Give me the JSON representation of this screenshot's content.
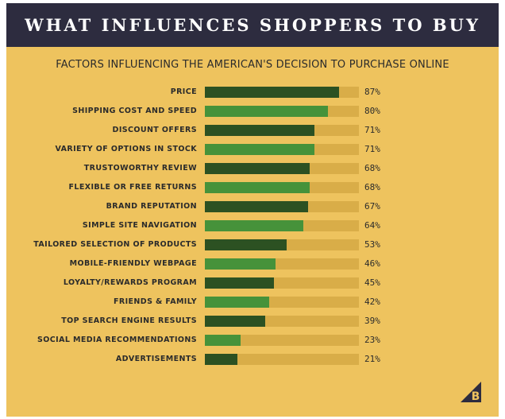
{
  "header": {
    "title": "WHAT INFLUENCES SHOPPERS TO BUY"
  },
  "colors": {
    "background": "#eec35e",
    "header": "#2d2c3f",
    "track": "#d9ad48",
    "dark_green": "#2c5122",
    "light_green": "#46923a"
  },
  "chart_data": {
    "type": "bar",
    "orientation": "horizontal",
    "title": "FACTORS INFLUENCING THE AMERICAN'S DECISION TO PURCHASE ONLINE",
    "xlim": [
      0,
      100
    ],
    "grid": false,
    "categories": [
      "PRICE",
      "SHIPPING COST AND SPEED",
      "DISCOUNT OFFERS",
      "VARIETY OF OPTIONS IN STOCK",
      "TRUSTOWORTHY REVIEW",
      "FLEXIBLE OR FREE RETURNS",
      "BRAND REPUTATION",
      "SIMPLE SITE NAVIGATION",
      "TAILORED SELECTION OF PRODUCTS",
      "MOBILE-FRIENDLY WEBPAGE",
      "LOYALTY/REWARDS PROGRAM",
      "FRIENDS & FAMILY",
      "TOP SEARCH ENGINE RESULTS",
      "SOCIAL MEDIA RECOMMENDATIONS",
      "ADVERTISEMENTS"
    ],
    "values": [
      87,
      80,
      71,
      71,
      68,
      68,
      67,
      64,
      53,
      46,
      45,
      42,
      39,
      23,
      21
    ],
    "value_labels": [
      "87%",
      "80%",
      "71%",
      "71%",
      "68%",
      "68%",
      "67%",
      "64%",
      "53%",
      "46%",
      "45%",
      "42%",
      "39%",
      "23%",
      "21%"
    ]
  },
  "logo": {
    "icon": "brand-b-logo-icon",
    "letter": "B"
  }
}
